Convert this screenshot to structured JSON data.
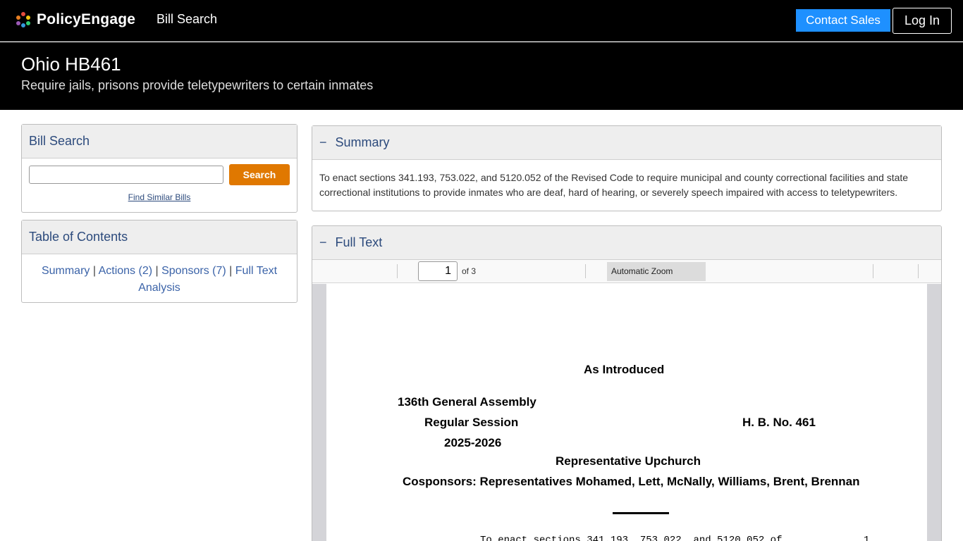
{
  "nav": {
    "brand": "PolicyEngage",
    "bill_search_link": "Bill Search",
    "contact_sales": "Contact Sales",
    "log_in": "Log In"
  },
  "bill": {
    "title": "Ohio HB461",
    "subtitle": "Require jails, prisons provide teletypewriters to certain inmates"
  },
  "search_panel": {
    "heading": "Bill Search",
    "input_value": "",
    "button": "Search",
    "find_similar": "Find Similar Bills"
  },
  "toc": {
    "heading": "Table of Contents",
    "items": [
      "Summary",
      "Actions (2)",
      "Sponsors (7)",
      "Full Text",
      "Analysis"
    ],
    "separator": "|"
  },
  "summary": {
    "toggle": "−",
    "heading": "Summary",
    "text": "To enact sections 341.193, 753.022, and 5120.052 of the Revised Code to require municipal and county correctional facilities and state correctional institutions to provide inmates who are deaf, hard of hearing, or severely speech impaired with access to teletypewriters."
  },
  "full_text": {
    "toggle": "−",
    "heading": "Full Text",
    "toolbar": {
      "page_number": "1",
      "page_of": "of 3",
      "zoom": "Automatic Zoom"
    },
    "document": {
      "status": "As Introduced",
      "assembly": "136th General Assembly",
      "session": "Regular Session",
      "years": "2025-2026",
      "bill_no": "H. B. No. 461",
      "sponsor": "Representative Upchurch",
      "cosponsors": "Cosponsors: Representatives Mohamed, Lett, McNally, Williams, Brent, Brennan",
      "first_line": "To enact sections 341.193, 753.022, and 5120.052 of",
      "first_line_number": "1"
    }
  },
  "colors": {
    "nav_bg": "#000000",
    "contact_sales": "#1e90ff",
    "search_button": "#e07800",
    "link": "#3b63a8",
    "panel_heading": "#2c4a7c"
  }
}
